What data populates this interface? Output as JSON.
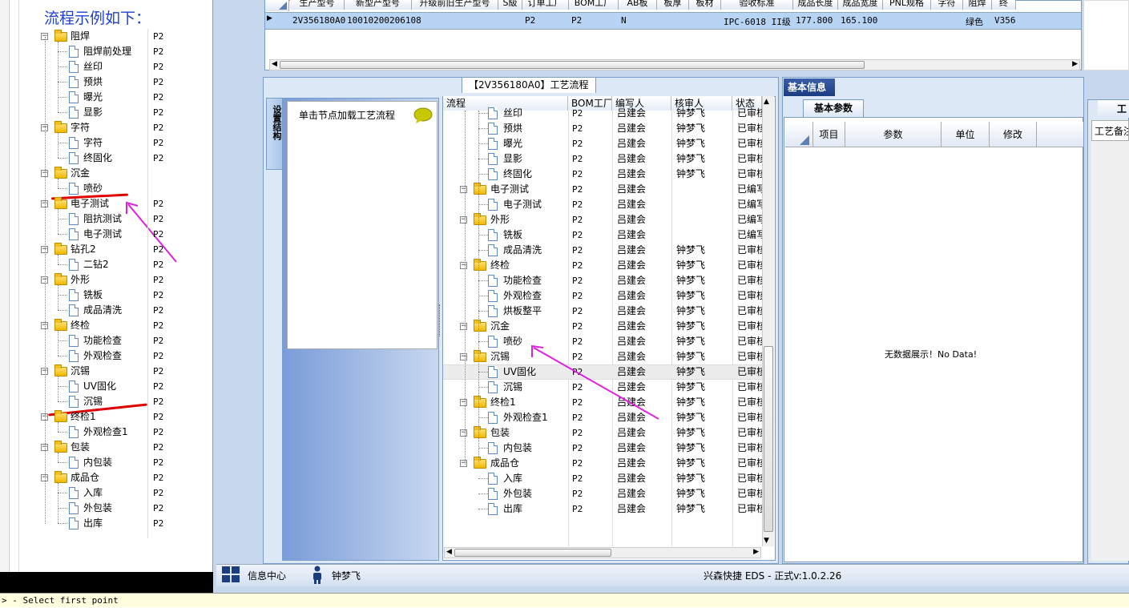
{
  "left_doc": {
    "title": "流程示例如下：",
    "tree": [
      {
        "label": "阻焊",
        "code": "P2",
        "level": 0
      },
      {
        "label": "阻焊前处理",
        "code": "P2",
        "level": 1
      },
      {
        "label": "丝印",
        "code": "P2",
        "level": 1
      },
      {
        "label": "预烘",
        "code": "P2",
        "level": 1
      },
      {
        "label": "曝光",
        "code": "P2",
        "level": 1
      },
      {
        "label": "显影",
        "code": "P2",
        "level": 1
      },
      {
        "label": "字符",
        "code": "P2",
        "level": 0
      },
      {
        "label": "字符",
        "code": "P2",
        "level": 1
      },
      {
        "label": "终固化",
        "code": "P2",
        "level": 1
      },
      {
        "label": "沉金",
        "code": "",
        "level": 0
      },
      {
        "label": "喷砂",
        "code": "",
        "level": 1
      },
      {
        "label": "电子测试",
        "code": "P2",
        "level": 0
      },
      {
        "label": "阻抗测试",
        "code": "P2",
        "level": 1
      },
      {
        "label": "电子测试",
        "code": "P2",
        "level": 1
      },
      {
        "label": "钻孔2",
        "code": "P2",
        "level": 0
      },
      {
        "label": "二钻2",
        "code": "P2",
        "level": 1
      },
      {
        "label": "外形",
        "code": "P2",
        "level": 0
      },
      {
        "label": "铣板",
        "code": "P2",
        "level": 1
      },
      {
        "label": "成品清洗",
        "code": "P2",
        "level": 1
      },
      {
        "label": "终检",
        "code": "P2",
        "level": 0
      },
      {
        "label": "功能检查",
        "code": "P2",
        "level": 1
      },
      {
        "label": "外观检查",
        "code": "P2",
        "level": 1
      },
      {
        "label": "沉锡",
        "code": "P2",
        "level": 0
      },
      {
        "label": "UV固化",
        "code": "P2",
        "level": 1
      },
      {
        "label": "沉锡",
        "code": "P2",
        "level": 1
      },
      {
        "label": "终检1",
        "code": "P2",
        "level": 0
      },
      {
        "label": "外观检查1",
        "code": "P2",
        "level": 1
      },
      {
        "label": "包装",
        "code": "P2",
        "level": 0
      },
      {
        "label": "内包装",
        "code": "P2",
        "level": 1
      },
      {
        "label": "成品仓",
        "code": "P2",
        "level": 0
      },
      {
        "label": "入库",
        "code": "P2",
        "level": 1
      },
      {
        "label": "外包装",
        "code": "P2",
        "level": 1
      },
      {
        "label": "出库",
        "code": "P2",
        "level": 1
      }
    ]
  },
  "top_grid": {
    "headers": [
      "生产型号",
      "新型产型号",
      "升级前旧生产型号",
      "S級",
      "订单工厂",
      "BOM工厂",
      "AB板",
      "板厚",
      "板材",
      "验收标准",
      "成品长度",
      "成品宽度",
      "PNL规格",
      "字符",
      "阻焊",
      "终"
    ],
    "row": [
      "2V356180A0",
      "10010200206108",
      "",
      "",
      "P2",
      "P2",
      "N",
      "",
      "",
      "IPC-6018 II级",
      "177.800",
      "165.100",
      "",
      "",
      "绿色",
      "V356"
    ]
  },
  "flow_panel": {
    "title": "【2V356180A0】工艺流程",
    "side_tab": "设置结构",
    "hint": "单击节点加载工艺流程",
    "columns": [
      "流程",
      "BOM工厂",
      "编写人",
      "核审人",
      "状态"
    ],
    "rows": [
      {
        "label": "丝印",
        "level": 1,
        "bom": "P2",
        "writer": "吕建会",
        "reviewer": "钟梦飞",
        "status": "已审核"
      },
      {
        "label": "预烘",
        "level": 1,
        "bom": "P2",
        "writer": "吕建会",
        "reviewer": "钟梦飞",
        "status": "已审核"
      },
      {
        "label": "曝光",
        "level": 1,
        "bom": "P2",
        "writer": "吕建会",
        "reviewer": "钟梦飞",
        "status": "已审核"
      },
      {
        "label": "显影",
        "level": 1,
        "bom": "P2",
        "writer": "吕建会",
        "reviewer": "钟梦飞",
        "status": "已审核"
      },
      {
        "label": "终固化",
        "level": 1,
        "bom": "P2",
        "writer": "吕建会",
        "reviewer": "钟梦飞",
        "status": "已审核"
      },
      {
        "label": "电子测试",
        "level": 0,
        "bom": "P2",
        "writer": "吕建会",
        "reviewer": "",
        "status": "已编写"
      },
      {
        "label": "电子测试",
        "level": 1,
        "bom": "P2",
        "writer": "吕建会",
        "reviewer": "",
        "status": "已编写"
      },
      {
        "label": "外形",
        "level": 0,
        "bom": "P2",
        "writer": "吕建会",
        "reviewer": "",
        "status": "已编写"
      },
      {
        "label": "铣板",
        "level": 1,
        "bom": "P2",
        "writer": "吕建会",
        "reviewer": "",
        "status": "已编写"
      },
      {
        "label": "成品清洗",
        "level": 1,
        "bom": "P2",
        "writer": "吕建会",
        "reviewer": "钟梦飞",
        "status": "已审核"
      },
      {
        "label": "终检",
        "level": 0,
        "bom": "P2",
        "writer": "吕建会",
        "reviewer": "钟梦飞",
        "status": "已审核"
      },
      {
        "label": "功能检查",
        "level": 1,
        "bom": "P2",
        "writer": "吕建会",
        "reviewer": "钟梦飞",
        "status": "已审核"
      },
      {
        "label": "外观检查",
        "level": 1,
        "bom": "P2",
        "writer": "吕建会",
        "reviewer": "钟梦飞",
        "status": "已审核"
      },
      {
        "label": "烘板整平",
        "level": 1,
        "bom": "P2",
        "writer": "吕建会",
        "reviewer": "钟梦飞",
        "status": "已审核"
      },
      {
        "label": "沉金",
        "level": 0,
        "bom": "P2",
        "writer": "吕建会",
        "reviewer": "钟梦飞",
        "status": "已审核"
      },
      {
        "label": "喷砂",
        "level": 1,
        "bom": "P2",
        "writer": "吕建会",
        "reviewer": "钟梦飞",
        "status": "已审核"
      },
      {
        "label": "沉锡",
        "level": 0,
        "bom": "P2",
        "writer": "吕建会",
        "reviewer": "钟梦飞",
        "status": "已审核"
      },
      {
        "label": "UV固化",
        "level": 1,
        "bom": "P2",
        "writer": "吕建会",
        "reviewer": "钟梦飞",
        "status": "已审核"
      },
      {
        "label": "沉锡",
        "level": 1,
        "bom": "P2",
        "writer": "吕建会",
        "reviewer": "钟梦飞",
        "status": "已审核"
      },
      {
        "label": "终检1",
        "level": 0,
        "bom": "P2",
        "writer": "吕建会",
        "reviewer": "钟梦飞",
        "status": "已审核"
      },
      {
        "label": "外观检查1",
        "level": 1,
        "bom": "P2",
        "writer": "吕建会",
        "reviewer": "钟梦飞",
        "status": "已审核"
      },
      {
        "label": "包装",
        "level": 0,
        "bom": "P2",
        "writer": "吕建会",
        "reviewer": "钟梦飞",
        "status": "已审核"
      },
      {
        "label": "内包装",
        "level": 1,
        "bom": "P2",
        "writer": "吕建会",
        "reviewer": "钟梦飞",
        "status": "已审核"
      },
      {
        "label": "成品仓",
        "level": 0,
        "bom": "P2",
        "writer": "吕建会",
        "reviewer": "钟梦飞",
        "status": "已审核"
      },
      {
        "label": "入库",
        "level": 1,
        "bom": "P2",
        "writer": "吕建会",
        "reviewer": "钟梦飞",
        "status": "已审核"
      },
      {
        "label": "外包装",
        "level": 1,
        "bom": "P2",
        "writer": "吕建会",
        "reviewer": "钟梦飞",
        "status": "已审核"
      },
      {
        "label": "出库",
        "level": 1,
        "bom": "P2",
        "writer": "吕建会",
        "reviewer": "钟梦飞",
        "status": "已审核"
      }
    ]
  },
  "basic_info": {
    "tab": "基本信息",
    "subtab": "基本参数",
    "columns": [
      "项目",
      "参数",
      "单位",
      "修改"
    ],
    "empty": "无数据展示！No Data!"
  },
  "right_panel": {
    "tab": "工",
    "label": "工艺备注"
  },
  "status_bar": {
    "info_center": "信息中心",
    "user": "钟梦飞",
    "version": "兴森快捷 EDS - 正式v:1.0.2.26"
  },
  "console": {
    "text": "> - Select first point"
  }
}
